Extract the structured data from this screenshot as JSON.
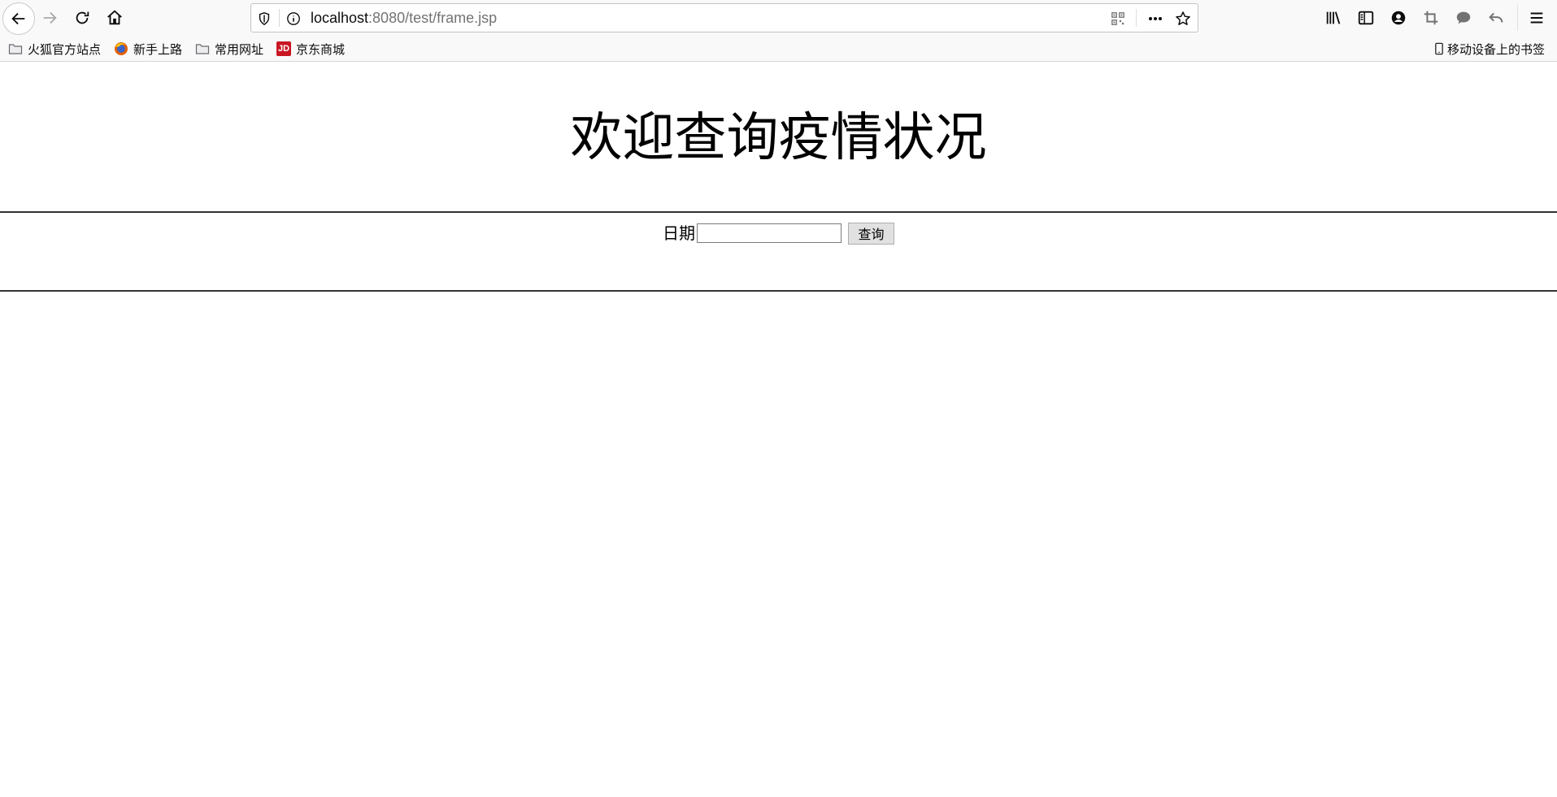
{
  "browser": {
    "url": {
      "host": "localhost",
      "rest": ":8080/test/frame.jsp"
    },
    "bookmarks": [
      {
        "label": "火狐官方站点",
        "icon": "folder-icon"
      },
      {
        "label": "新手上路",
        "icon": "firefox-icon"
      },
      {
        "label": "常用网址",
        "icon": "folder-icon"
      },
      {
        "label": "京东商城",
        "icon": "jd-icon"
      }
    ],
    "mobile_bookmarks": "移动设备上的书签",
    "jd_badge": "JD"
  },
  "page": {
    "title": "欢迎查询疫情状况",
    "date_label": "日期",
    "date_value": "",
    "query_button": "查询"
  }
}
